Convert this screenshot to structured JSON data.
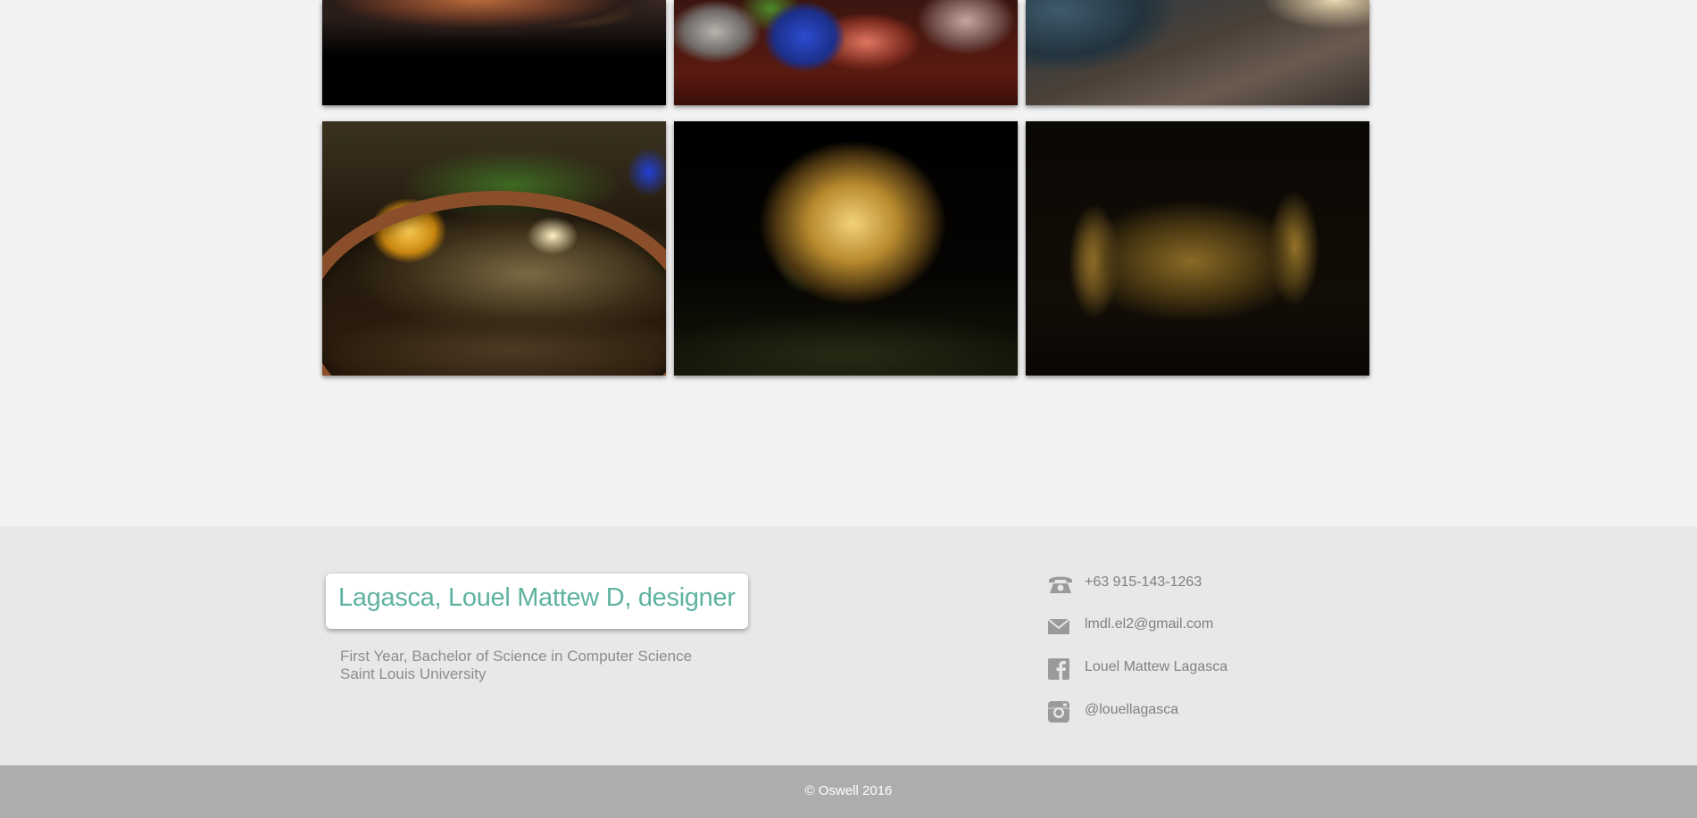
{
  "gallery": {
    "photos": [
      {
        "name": "photo-painted-hand",
        "row": 1
      },
      {
        "name": "photo-colorful-objects",
        "row": 1
      },
      {
        "name": "photo-beach-reflection",
        "row": 1
      },
      {
        "name": "photo-fountain-reflection",
        "row": 2
      },
      {
        "name": "photo-lit-mansion",
        "row": 2
      },
      {
        "name": "photo-lit-trees",
        "row": 2
      }
    ]
  },
  "footer": {
    "name_title": "Lagasca, Louel Mattew D, designer",
    "bio_line1": "First Year, Bachelor of Science in Computer Science",
    "bio_line2": "Saint Louis University",
    "contacts": {
      "phone": {
        "icon": "phone-icon",
        "text": "+63 915-143-1263"
      },
      "email": {
        "icon": "mail-icon",
        "text": "lmdl.el2@gmail.com"
      },
      "facebook": {
        "icon": "facebook-icon",
        "text": "Louel Mattew Lagasca"
      },
      "instagram": {
        "icon": "instagram-icon",
        "text": "@louellagasca"
      }
    },
    "copyright": "© Oswell 2016"
  },
  "colors": {
    "accent_name": "#5fb2a0",
    "footer_bg": "#e8e8e8",
    "bottom_bar": "#adadad",
    "page_bg": "#f2f2f2"
  }
}
